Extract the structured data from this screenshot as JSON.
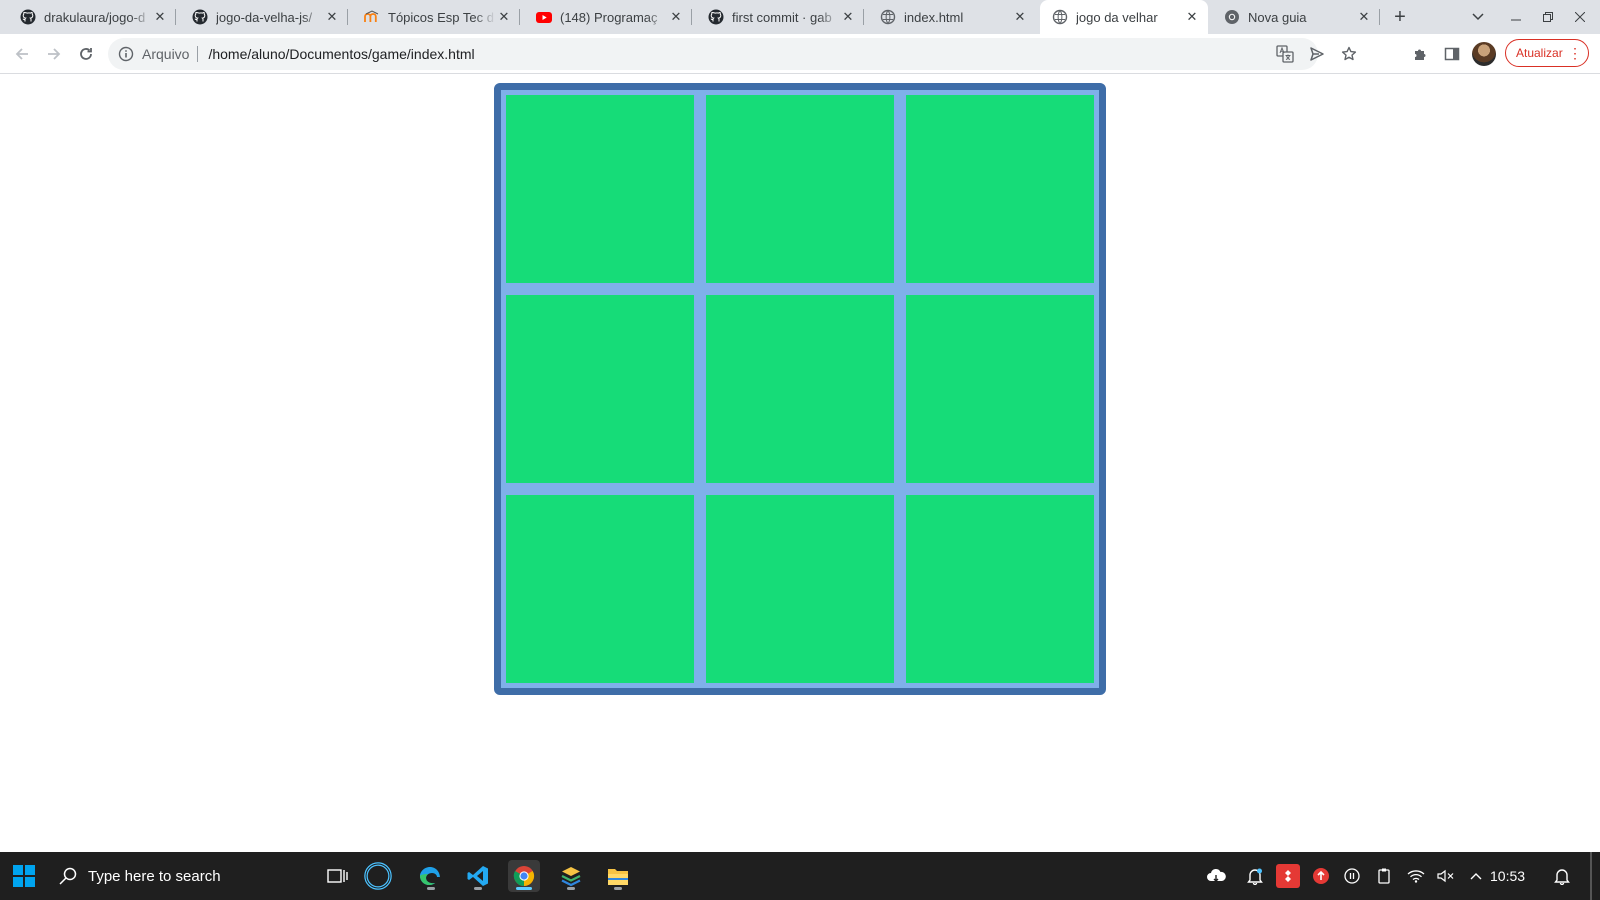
{
  "browser": {
    "tabs": [
      {
        "title": "drakulaura/jogo-d",
        "favicon": "github-icon",
        "active": false
      },
      {
        "title": "jogo-da-velha-js/",
        "favicon": "github-icon",
        "active": false
      },
      {
        "title": "Tópicos Esp Tec d",
        "favicon": "moodle-icon",
        "active": false
      },
      {
        "title": "(148) Programaç",
        "favicon": "youtube-icon",
        "active": false
      },
      {
        "title": "first commit · gab",
        "favicon": "github-icon",
        "active": false
      },
      {
        "title": "index.html",
        "favicon": "globe-icon",
        "active": false
      },
      {
        "title": "jogo da velhar",
        "favicon": "globe-icon",
        "active": true
      },
      {
        "title": "Nova guia",
        "favicon": "chrome-icon",
        "active": false
      }
    ],
    "omnibox": {
      "scheme_label": "Arquivo",
      "url": "/home/aluno/Documentos/game/index.html"
    },
    "update_label": "Atualizar"
  },
  "page": {
    "board": {
      "cells": [
        "",
        "",
        "",
        "",
        "",
        "",
        "",
        "",
        ""
      ],
      "cell_color": "#16dc78",
      "grid_color": "#7fb0ea",
      "border_color": "#3e6da8"
    }
  },
  "taskbar": {
    "search_placeholder": "Type here to search",
    "clock": "10:53",
    "apps": [
      "task-view-icon",
      "cortana-icon",
      "edge-icon",
      "vscode-icon",
      "chrome-icon",
      "layers-app-icon",
      "file-explorer-icon"
    ]
  }
}
